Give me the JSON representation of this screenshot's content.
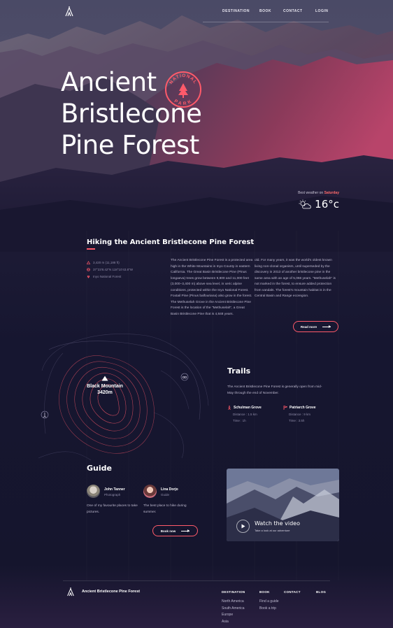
{
  "nav": {
    "logo_icon": "tent-icon",
    "links": [
      "DESTINATION",
      "BOOK",
      "CONTACT",
      "LOGIN"
    ]
  },
  "hero": {
    "title_lines": [
      "Ancient",
      "Bristlecone",
      "Pine Forest"
    ],
    "badge_text_top": "NATIONAL",
    "badge_text_bottom": "PARK",
    "badge_icon": "pine-tree-icon"
  },
  "weather": {
    "label": "Best weather on",
    "day": "Saturday",
    "icon": "sun-cloud-icon",
    "temperature": "16°c"
  },
  "hiking": {
    "title": "Hiking the Ancient Bristlecone Pine Forest",
    "facts": [
      {
        "icon": "mountain-icon",
        "text": "3,420 m (11,188 ft)"
      },
      {
        "icon": "globe-icon",
        "text": "37°23'8.42\"N 118°10'43.8\"W"
      },
      {
        "icon": "location-pin-icon",
        "text": "Inyo National Forest"
      }
    ],
    "col1_paragraphs": [
      "The Ancient Bristlecone Pine Forest is a protected area high in the White Mountains in Inyo County in eastern California. The Great Basin Bristlecone Pine (Pinus longaeva) trees grow between 9,800 and 11,000 feet (3,000–3,400 m) above sea level, in xeric alpine conditions, protected within the Inyo National Forest. Foxtail Pine (Pinus balfouriana) also grow in the forest.",
      "The Methuselah Grove in the Ancient Bristlecone Pine Forest is the location of the \"Methuselah\", a Great Basin Bristlecone Pine that is 4,848 years."
    ],
    "col2_paragraphs": [
      "old. For many years, it was the world's oldest known living non-clonal organism, until superseded by the discovery in 2013 of another bristlecone pine in the same area with an age of 5,066 years. \"Methuselah\" is not marked in the forest, to ensure added protection from vandals. The forest's mountain habitat is in the Central Basin and Range ecoregion."
    ],
    "read_more": "Read more"
  },
  "map": {
    "peak_icon": "mountain-icon",
    "peak_name": "Black Mountain",
    "peak_height": "3420m",
    "pin_icons": [
      "binoculars-icon",
      "hiker-icon"
    ]
  },
  "trails": {
    "title": "Trails",
    "text": "The Ancient Bristlecone Pine Forest is generally open from mid-May through the end of November.",
    "items": [
      {
        "icon": "hiker-icon",
        "name": "Schulman Grove",
        "distance": "Distance : 1.5 km",
        "time": "Time : 1h"
      },
      {
        "icon": "flag-icon",
        "name": "Patriarch Grove",
        "distance": "Distance : 9 km",
        "time": "Time : 3.5h"
      }
    ]
  },
  "guide": {
    "title": "Guide",
    "people": [
      {
        "name": "John Tanner",
        "role": "Photograph",
        "text": "One of my favourite places to take pictures."
      },
      {
        "name": "Lina Dorjo",
        "role": "Guide",
        "text": "The best place to hike during summer."
      }
    ],
    "book_button": "Book now"
  },
  "video": {
    "title": "Watch the video",
    "subtitle": "Take a look at our adventure",
    "play_icon": "play-icon"
  },
  "footer": {
    "brand": "Ancient Bristlecone Pine Forest",
    "columns": [
      {
        "head": "DESTINATION",
        "items": [
          "North America",
          "South America",
          "Europe",
          "Asia"
        ]
      },
      {
        "head": "BOOK",
        "items": [
          "Find a guide",
          "Book a trip"
        ]
      },
      {
        "head": "CONTACT",
        "items": []
      },
      {
        "head": "BLOG",
        "items": []
      }
    ]
  },
  "colors": {
    "accent": "#ff5a6a",
    "background": "#15152d"
  }
}
